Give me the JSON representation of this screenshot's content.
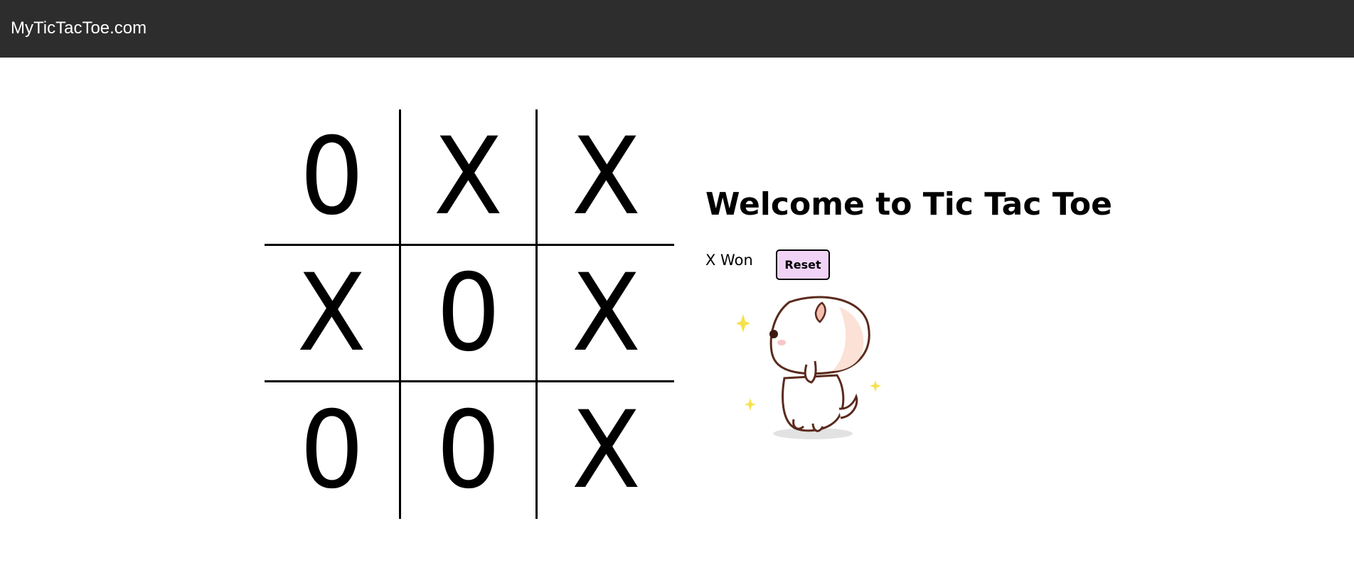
{
  "navbar": {
    "brand": "MyTicTacToe.com"
  },
  "board": {
    "cells": [
      [
        "0",
        "X",
        "X"
      ],
      [
        "X",
        "0",
        "X"
      ],
      [
        "0",
        "0",
        "X"
      ]
    ]
  },
  "panel": {
    "title": "Welcome to Tic Tac Toe",
    "status": "X Won",
    "reset_label": "Reset",
    "mascot_icon": "cat-mascot-icon"
  },
  "colors": {
    "navbar_bg": "#2d2d2d",
    "reset_bg": "#f2d3f8",
    "sparkle": "#f7e04b"
  }
}
